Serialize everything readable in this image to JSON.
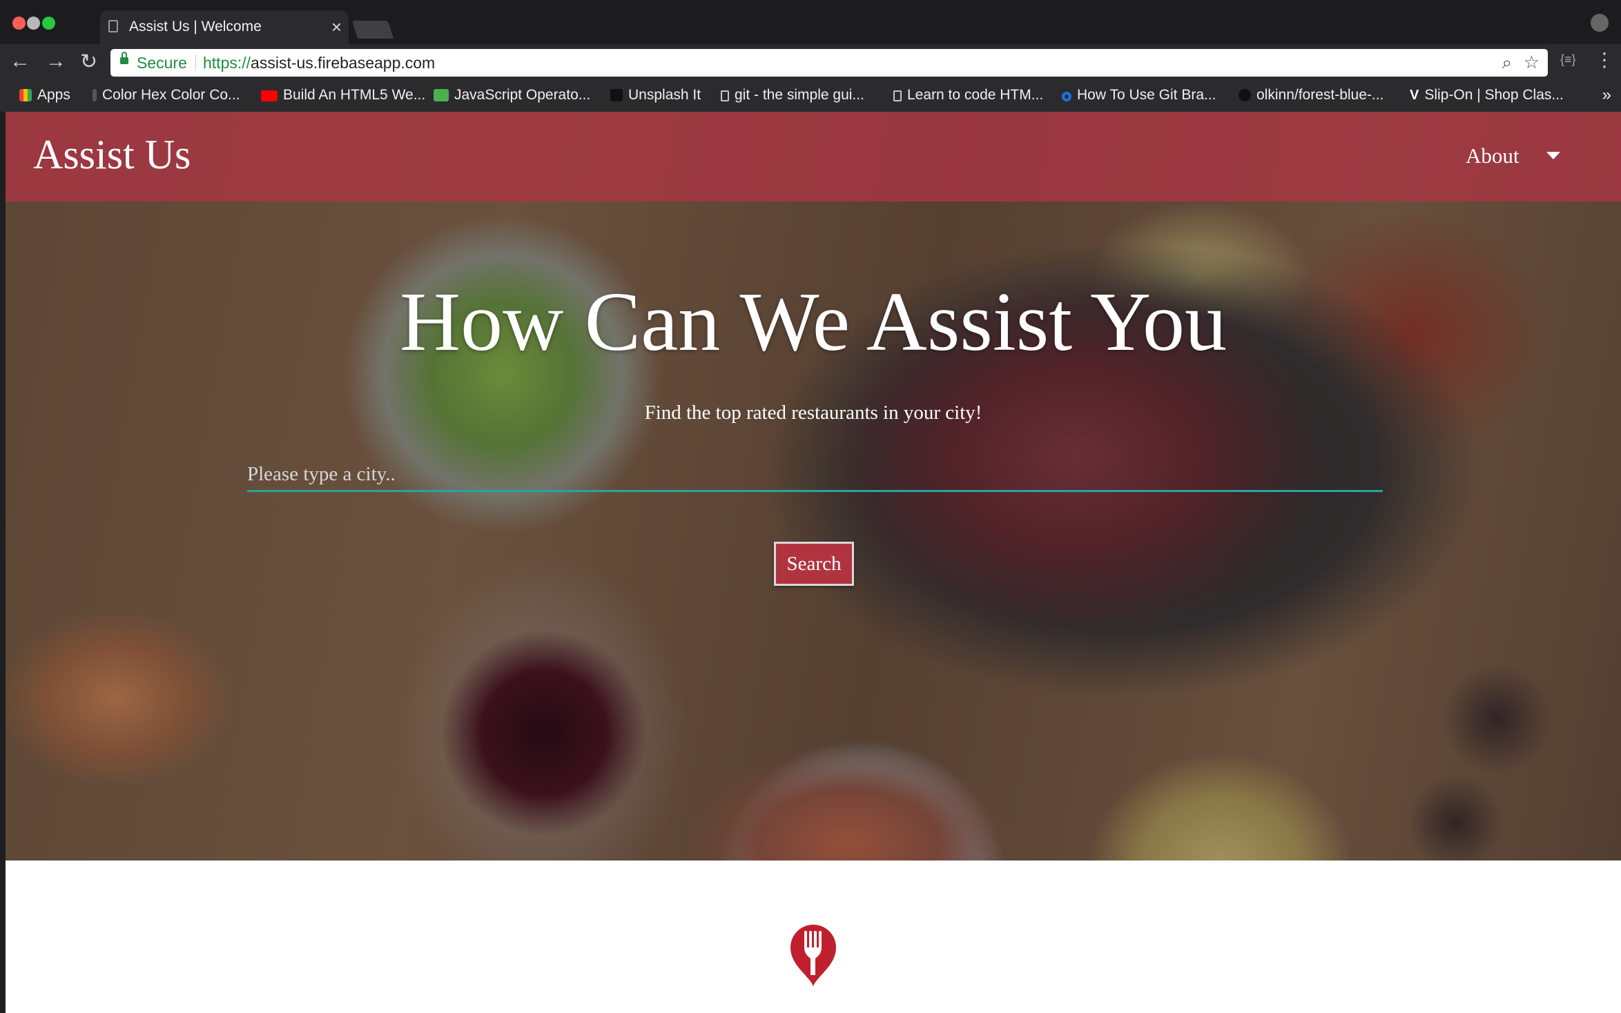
{
  "browser": {
    "tab_title": "Assist Us | Welcome",
    "tab_close": "×",
    "secure_label": "Secure",
    "url_scheme": "https://",
    "url_host": "assist-us.firebaseapp.com",
    "bookmarks": [
      {
        "label": "Apps",
        "icon": "apps-grid-icon",
        "color": "#ea4335"
      },
      {
        "label": "Color Hex Color Co...",
        "icon": "color-hex-icon",
        "color": "#555555"
      },
      {
        "label": "Build An HTML5 We...",
        "icon": "youtube-icon",
        "color": "#ff0000"
      },
      {
        "label": "JavaScript Operato...",
        "icon": "w3schools-icon",
        "color": "#4caf50"
      },
      {
        "label": "Unsplash It",
        "icon": "unsplash-icon",
        "color": "#111111"
      },
      {
        "label": "git - the simple gui...",
        "icon": "page-icon",
        "color": "#c7c7c7"
      },
      {
        "label": "Learn to code HTM...",
        "icon": "page-icon",
        "color": "#c7c7c7"
      },
      {
        "label": "How To Use Git Bra...",
        "icon": "digitalocean-icon",
        "color": "#1a73e8"
      },
      {
        "label": "olkinn/forest-blue-...",
        "icon": "github-icon",
        "color": "#111111"
      },
      {
        "label": "Slip-On | Shop Clas...",
        "icon": "vans-icon",
        "color": "#ffffff"
      }
    ],
    "more_bookmarks": "»"
  },
  "site": {
    "brand": "Assist Us",
    "nav_about": "About",
    "headline": "How Can We Assist You",
    "subtitle": "Find the top rated restaurants in your city!",
    "search_placeholder": "Please type a city..",
    "search_button": "Search",
    "logo_icon": "fork-location-pin-icon"
  },
  "colors": {
    "navbar": "#aa3444",
    "button": "#b0343f",
    "input_underline": "#26a69a",
    "logo": "#c0202e"
  }
}
